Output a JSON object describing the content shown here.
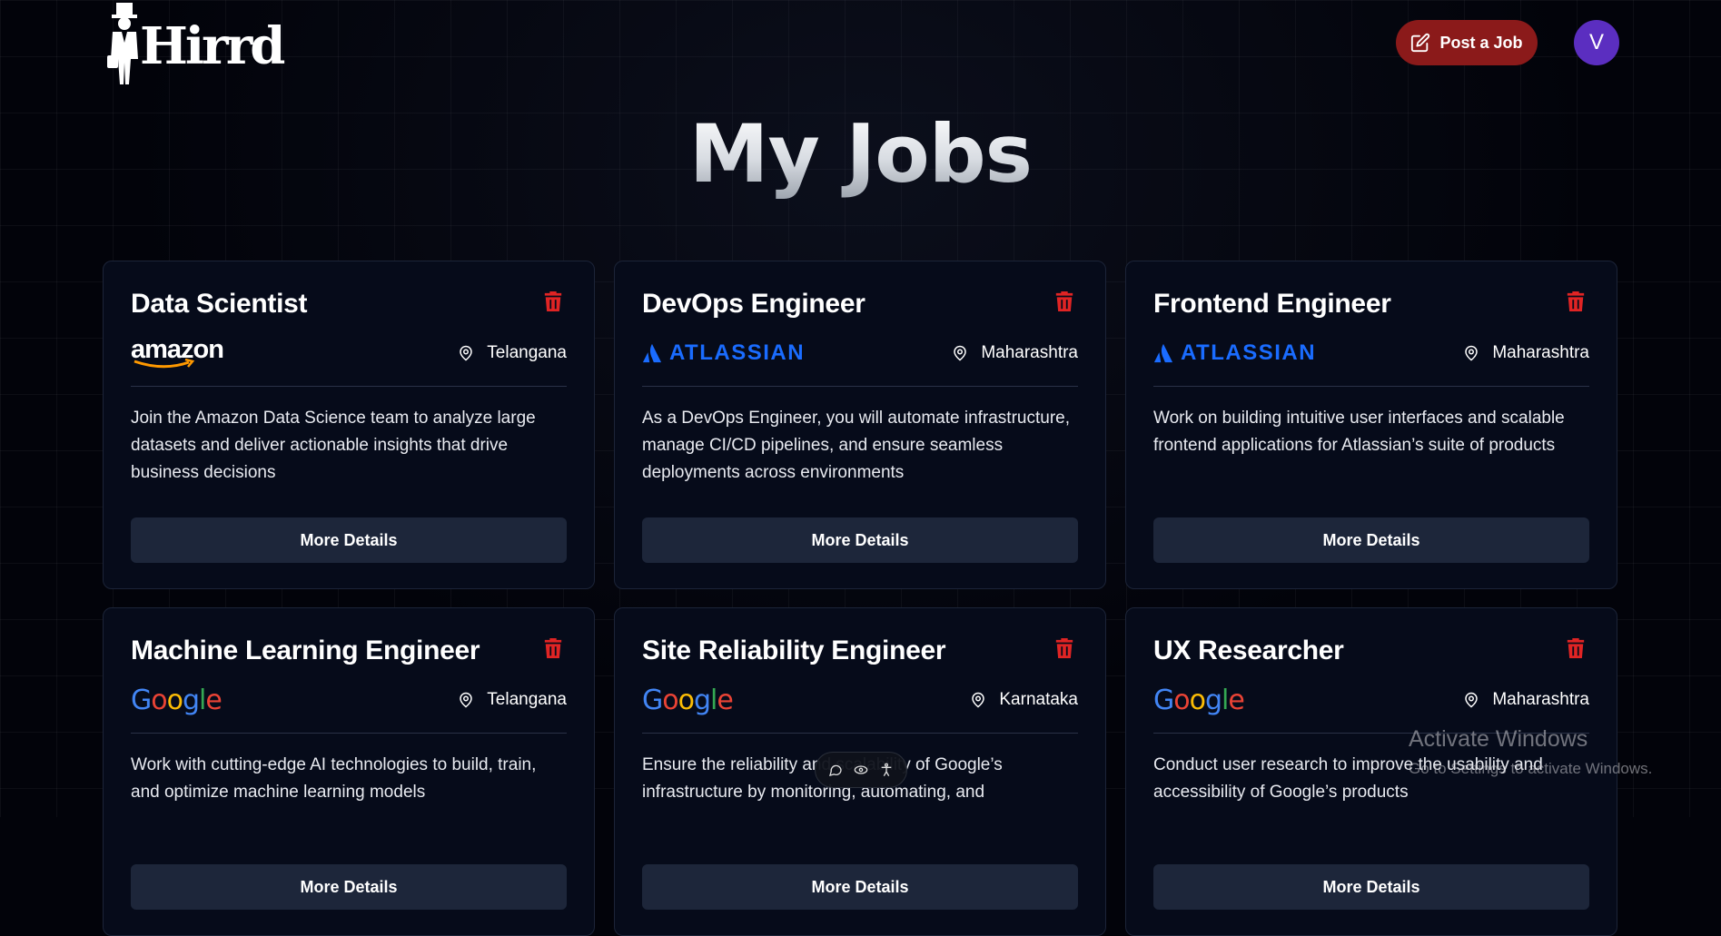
{
  "header": {
    "logo_text": "Hirrd",
    "post_job_label": "Post a Job",
    "avatar_initial": "V"
  },
  "page": {
    "title": "My Jobs"
  },
  "jobs": [
    {
      "title": "Data Scientist",
      "company": "amazon",
      "location": "Telangana",
      "description": "Join the Amazon Data Science team to analyze large datasets and deliver actionable insights that drive business decisions",
      "button_label": "More Details"
    },
    {
      "title": "DevOps Engineer",
      "company": "ATLASSIAN",
      "location": "Maharashtra",
      "description": "As a DevOps Engineer, you will automate infrastructure, manage CI/CD pipelines, and ensure seamless deployments across environments",
      "button_label": "More Details"
    },
    {
      "title": "Frontend Engineer",
      "company": "ATLASSIAN",
      "location": "Maharashtra",
      "description": "Work on building intuitive user interfaces and scalable frontend applications for Atlassian’s suite of products",
      "button_label": "More Details"
    },
    {
      "title": "Machine Learning Engineer",
      "company": "Google",
      "location": "Telangana",
      "description": "Work with cutting-edge AI technologies to build, train, and optimize machine learning models",
      "button_label": "More Details"
    },
    {
      "title": "Site Reliability Engineer",
      "company": "Google",
      "location": "Karnataka",
      "description": "Ensure the reliability and scalability of Google’s infrastructure by monitoring, automating, and",
      "button_label": "More Details"
    },
    {
      "title": "UX Researcher",
      "company": "Google",
      "location": "Maharashtra",
      "description": "Conduct user research to improve the usability and accessibility of Google’s products",
      "button_label": "More Details"
    }
  ],
  "windows_watermark": {
    "line1": "Activate Windows",
    "line2": "Go to Settings to activate Windows."
  },
  "icons": [
    "top-hat-man-logo-icon",
    "edit-icon",
    "trash-icon",
    "map-pin-icon",
    "chat-icon",
    "eye-icon",
    "accessibility-icon"
  ],
  "colors": {
    "post_button": "#8b1a1a",
    "avatar": "#5b2ec0",
    "trash": "#e02424",
    "atlassian_blue": "#1a6cff",
    "card_bg": "#060b1a"
  }
}
